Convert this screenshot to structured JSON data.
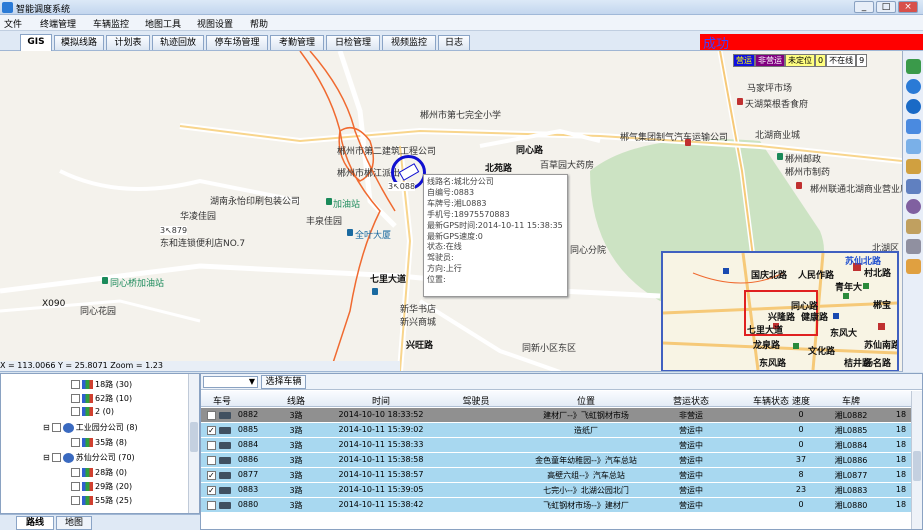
{
  "window": {
    "title": "智能调度系统",
    "min": "_",
    "max": "□",
    "close": "×"
  },
  "menu": [
    "文件",
    "终端管理",
    "车辆监控",
    "地图工具",
    "视图设置",
    "帮助"
  ],
  "tabs": [
    "GIS",
    "模拟线路",
    "计划表",
    "轨迹回放",
    "停车场管理",
    "考勤管理",
    "日检管理",
    "视频监控",
    "日志"
  ],
  "status_text": "成功",
  "legend": {
    "items": [
      {
        "label": "营运",
        "color": "#1010e0"
      },
      {
        "label": "非营运",
        "color": "#800080"
      },
      {
        "label": "未定位",
        "color": "#ffff80"
      },
      {
        "label": "0",
        "color": "#ffff80"
      },
      {
        "label": "不在线",
        "color": "#ffffff"
      },
      {
        "label": "9",
        "color": "#ffffff"
      }
    ]
  },
  "map_labels": [
    "郴州市第七完全小学",
    "郴州市第二建筑工程公司",
    "郴州市郴江派出",
    "湖南永怡印刷包装公司",
    "华凌佳园",
    "东和连锁便利店NO.7",
    "加油站",
    "全叶大厦",
    "丰泉佳园",
    "同心桥加油站",
    "同心花园",
    "同心分院",
    "百草园大药房",
    "郴气集团制气汽车运输公司",
    "马家坪市场",
    "天湖菜根香食府",
    "北湖商业城",
    "郴州市制药",
    "郴州邮政",
    "郴州联通北湖商业营业厅",
    "北湖区",
    "新华书店",
    "新兴商城",
    "同新小区东区",
    "天湖菜根香食府"
  ],
  "roads": [
    "北苑路",
    "同心路",
    "七里大道",
    "兴旺路",
    "X090"
  ],
  "vehicle_badge": "3↖088",
  "vehicle_badge2": "3↖879",
  "popup": [
    "线路名:城北分公司",
    "自编号:0883",
    "车牌号:湘L0883",
    "手机号:18975570883",
    "最新GPS时间:2014-10-11 15:38:35",
    "最新GPS速度:0",
    "状态:在线",
    "驾驶员:",
    "方向:上行",
    "位置:"
  ],
  "minimap_labels": [
    "苏仙北路",
    "国庆北路",
    "人民作路",
    "青年大",
    "同心路",
    "七里大道",
    "龙泉路",
    "东风路",
    "文化路",
    "郴宝",
    "兴隆路",
    "健康路",
    "东风大",
    "苏仙南路",
    "桔井路",
    "村北路",
    "扬名路"
  ],
  "coords": "X = 113.0066   Y = 25.8071   Zoom = 1.23",
  "tree": [
    {
      "label": "18路 (30)",
      "checked": false
    },
    {
      "label": "62路 (10)",
      "checked": false
    },
    {
      "label": "2 (0)",
      "checked": false
    },
    {
      "label": "工业园分公司 (8)",
      "checked": false,
      "group": true
    },
    {
      "label": "35路 (8)",
      "checked": false
    },
    {
      "label": "苏仙分公司 (70)",
      "checked": false,
      "group": true
    },
    {
      "label": "28路 (0)",
      "checked": false
    },
    {
      "label": "29路 (20)",
      "checked": false
    },
    {
      "label": "55路 (25)",
      "checked": false
    }
  ],
  "left_tabs": [
    "路线",
    "地图"
  ],
  "grid": {
    "select_btn": "选择车辆",
    "headers": [
      "车号",
      "线路",
      "时间",
      "驾驶员",
      "位置",
      "营运状态",
      "车辆状态",
      "速度",
      "车牌",
      ""
    ],
    "rows": [
      {
        "checked": false,
        "num": "0882",
        "line": "3路",
        "time": "2014-10-10 18:33:52",
        "driver": "",
        "pos": "建材厂--》飞虹钢材市场",
        "op": "非营运",
        "vs": "",
        "speed": "0",
        "plate": "湘L0882",
        "extra": "18",
        "bg": "#909090"
      },
      {
        "checked": true,
        "num": "0885",
        "line": "3路",
        "time": "2014-10-11 15:39:02",
        "driver": "",
        "pos": "造纸厂",
        "op": "营运中",
        "vs": "",
        "speed": "0",
        "plate": "湘L0885",
        "extra": "18",
        "bg": "#a8d8f0"
      },
      {
        "checked": false,
        "num": "0884",
        "line": "3路",
        "time": "2014-10-11 15:38:33",
        "driver": "",
        "pos": "",
        "op": "营运中",
        "vs": "",
        "speed": "0",
        "plate": "湘L0884",
        "extra": "18",
        "bg": "#a8d8f0"
      },
      {
        "checked": false,
        "num": "0886",
        "line": "3路",
        "time": "2014-10-11 15:38:58",
        "driver": "",
        "pos": "金色童年幼稚园--》汽车总站",
        "op": "营运中",
        "vs": "",
        "speed": "37",
        "plate": "湘L0886",
        "extra": "18",
        "bg": "#a8d8f0"
      },
      {
        "checked": true,
        "num": "0877",
        "line": "3路",
        "time": "2014-10-11 15:38:57",
        "driver": "",
        "pos": "高壁六组--》汽车总站",
        "op": "营运中",
        "vs": "",
        "speed": "8",
        "plate": "湘L0877",
        "extra": "18",
        "bg": "#a8d8f0"
      },
      {
        "checked": true,
        "num": "0883",
        "line": "3路",
        "time": "2014-10-11 15:39:05",
        "driver": "",
        "pos": "七完小--》北湖公园北门",
        "op": "营运中",
        "vs": "",
        "speed": "23",
        "plate": "湘L0883",
        "extra": "18",
        "bg": "#a8d8f0"
      },
      {
        "checked": false,
        "num": "0880",
        "line": "3路",
        "time": "2014-10-11 15:38:42",
        "driver": "",
        "pos": "飞虹钢材市场--》建材厂",
        "op": "营运中",
        "vs": "",
        "speed": "0",
        "plate": "湘L0880",
        "extra": "18",
        "bg": "#a8d8f0"
      }
    ]
  }
}
